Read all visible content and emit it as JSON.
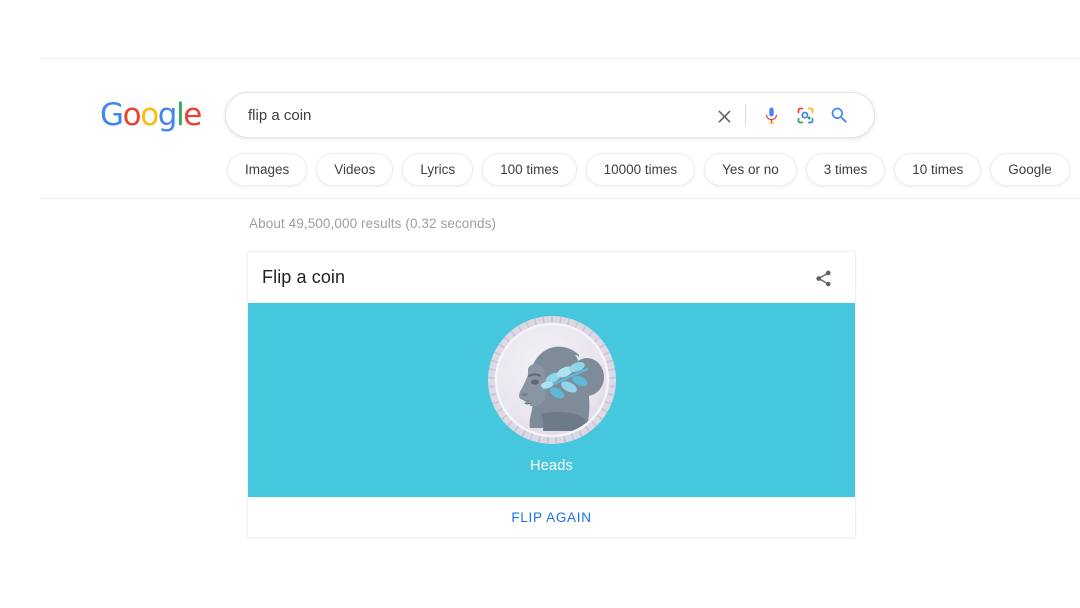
{
  "brand": {
    "logo_letters": [
      {
        "char": "G",
        "color": "#4285F4"
      },
      {
        "char": "o",
        "color": "#EA4335"
      },
      {
        "char": "o",
        "color": "#FBBC05"
      },
      {
        "char": "g",
        "color": "#4285F4"
      },
      {
        "char": "l",
        "color": "#34A853"
      },
      {
        "char": "e",
        "color": "#EA4335"
      }
    ],
    "logo_text": "Google"
  },
  "search": {
    "value": "flip a coin",
    "placeholder": "Search",
    "icons": {
      "clear": "close-icon",
      "voice": "microphone-icon",
      "lens": "google-lens-icon",
      "submit": "search-icon"
    }
  },
  "chips": [
    {
      "label": "Images"
    },
    {
      "label": "Videos"
    },
    {
      "label": "Lyrics"
    },
    {
      "label": "100 times"
    },
    {
      "label": "10000 times"
    },
    {
      "label": "Yes or no"
    },
    {
      "label": "3 times"
    },
    {
      "label": "10 times"
    },
    {
      "label": "Google"
    }
  ],
  "results": {
    "stats": "About 49,500,000 results (0.32 seconds)"
  },
  "coin_card": {
    "title": "Flip a coin",
    "share_icon": "share-icon",
    "result_label": "Heads",
    "flip_again_label": "FLIP AGAIN",
    "colors": {
      "stage_background": "#45c8dd",
      "coin_face": "#e9e7ee",
      "coin_rim": "#dcd8e4",
      "silhouette": "#7e8b99",
      "silhouette_shadow": "#6d7a88",
      "leaf": "#8fd6ea",
      "leaf_dark": "#5fb8d6",
      "link": "#1a73e8",
      "result_text": "#ffffff"
    }
  }
}
